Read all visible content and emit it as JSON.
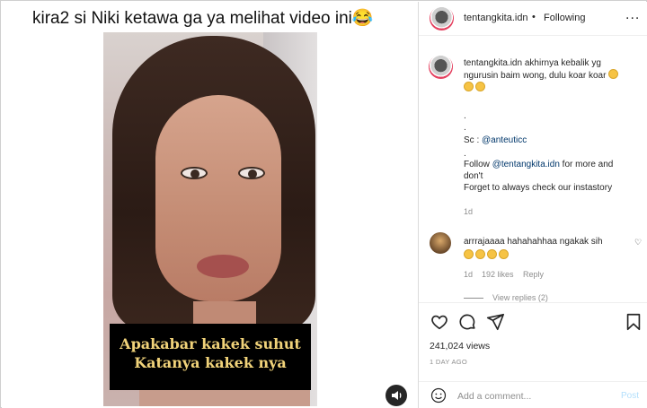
{
  "media": {
    "caption": "kira2 si Niki ketawa ga ya melihat video ini😂",
    "subtitle_line1": "Apakabar kakek suhut",
    "subtitle_line2": "Katanya kakek nya",
    "sound_icon": "speaker-icon"
  },
  "header": {
    "username": "tentangkita.idn",
    "separator": "•",
    "follow_status": "Following",
    "more": "..."
  },
  "post_caption": {
    "username": "tentangkita.idn",
    "text_line1": "akhirnya kebalik yg",
    "text_line2": "ngurusin baim wong, dulu koar koar",
    "dot1": ".",
    "dot2": ".",
    "source_label": "Sc : ",
    "source_handle": "@anteuticc",
    "dot3": ".",
    "follow_prefix": "Follow ",
    "follow_handle": "@tentangkita.idn",
    "follow_suffix": " for more and",
    "dont": "don't",
    "forget": "Forget to always check our instastory",
    "age": "1d"
  },
  "comment": {
    "username": "arrrajaaaa",
    "text": "hahahahhaa ngakak sih",
    "age": "1d",
    "likes": "192 likes",
    "reply": "Reply",
    "view_replies": "View replies (2)"
  },
  "stats": {
    "views": "241,024 views",
    "time_ago": "1 DAY AGO"
  },
  "add_comment": {
    "placeholder": "Add a comment...",
    "post_label": "Post"
  },
  "colors": {
    "link": "#00376b",
    "muted": "#8e8e8e",
    "subtitle_text": "#f1d37a",
    "post_disabled": "#b2dffc"
  }
}
